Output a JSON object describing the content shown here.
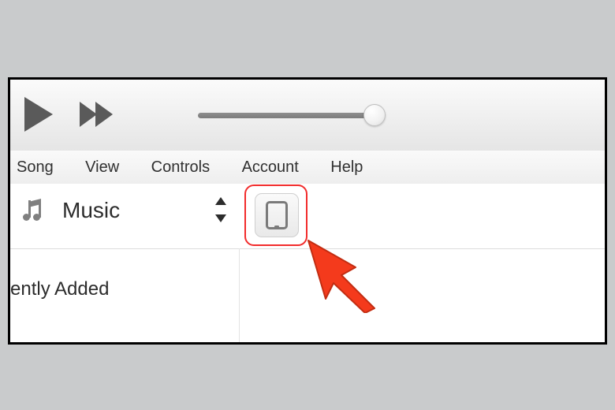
{
  "menu": {
    "song": "Song",
    "view": "View",
    "controls": "Controls",
    "account": "Account",
    "help": "Help"
  },
  "library_picker": {
    "label": "Music"
  },
  "sidebar": {
    "recently_added": "ently Added"
  }
}
